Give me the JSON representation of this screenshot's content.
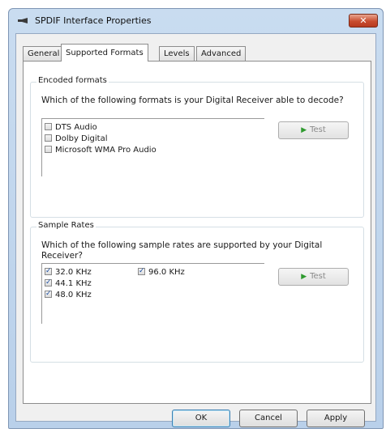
{
  "window": {
    "title": "SPDIF Interface Properties",
    "close_label": "✕"
  },
  "tabs": [
    {
      "label": "General"
    },
    {
      "label": "Supported Formats",
      "active": true
    },
    {
      "label": "Levels"
    },
    {
      "label": "Advanced"
    }
  ],
  "encoded": {
    "group_label": "Encoded formats",
    "question": "Which of the following formats is your Digital Receiver able to decode?",
    "items": [
      {
        "label": "DTS Audio",
        "checked": false
      },
      {
        "label": "Dolby Digital",
        "checked": false
      },
      {
        "label": "Microsoft WMA Pro Audio",
        "checked": false
      }
    ],
    "test_label": "Test"
  },
  "rates": {
    "group_label": "Sample Rates",
    "question": "Which of the following sample rates are supported by your Digital Receiver?",
    "items": [
      {
        "label": "32.0 KHz",
        "checked": true
      },
      {
        "label": "44.1 KHz",
        "checked": true
      },
      {
        "label": "48.0 KHz",
        "checked": true
      },
      {
        "label": "96.0 KHz",
        "checked": true
      }
    ],
    "test_label": "Test"
  },
  "buttons": {
    "ok": "OK",
    "cancel": "Cancel",
    "apply": "Apply"
  },
  "colors": {
    "play_icon": "#2e9a2e",
    "close_button": "#c84d2f"
  }
}
